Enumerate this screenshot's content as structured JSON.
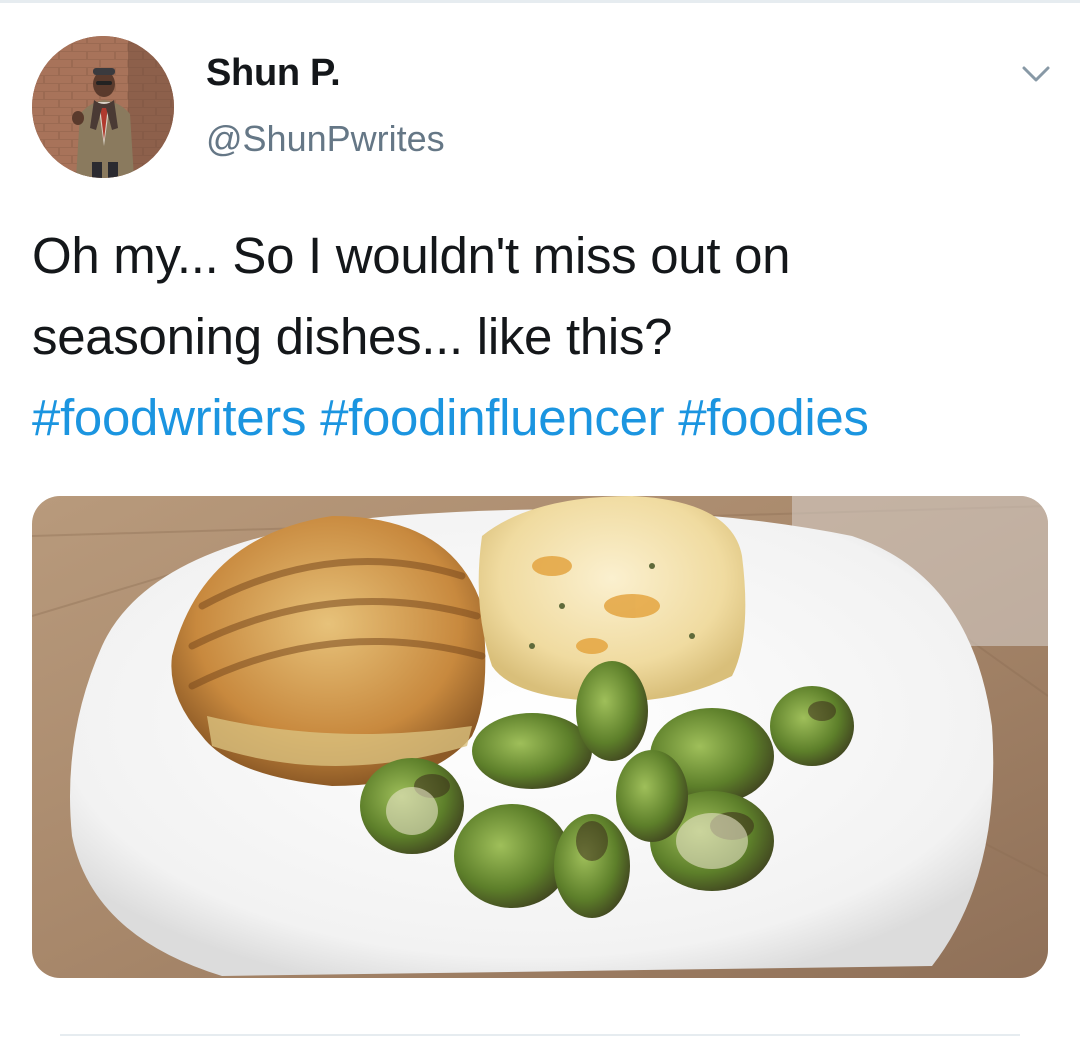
{
  "tweet": {
    "author": {
      "display_name": "Shun P.",
      "handle": "@ShunPwrites"
    },
    "text_lines": [
      "Oh my... So I wouldn't miss out on",
      "seasoning dishes... like this?"
    ],
    "hashtags": [
      "#foodwriters",
      "#foodinfluencer",
      "#foodies"
    ],
    "menu_icon": "chevron-down-icon",
    "media_description_icon": "photo"
  },
  "colors": {
    "text": "#14171a",
    "secondary": "#657786",
    "hashtag": "#1b95e0",
    "divider": "#e6ecf0"
  }
}
